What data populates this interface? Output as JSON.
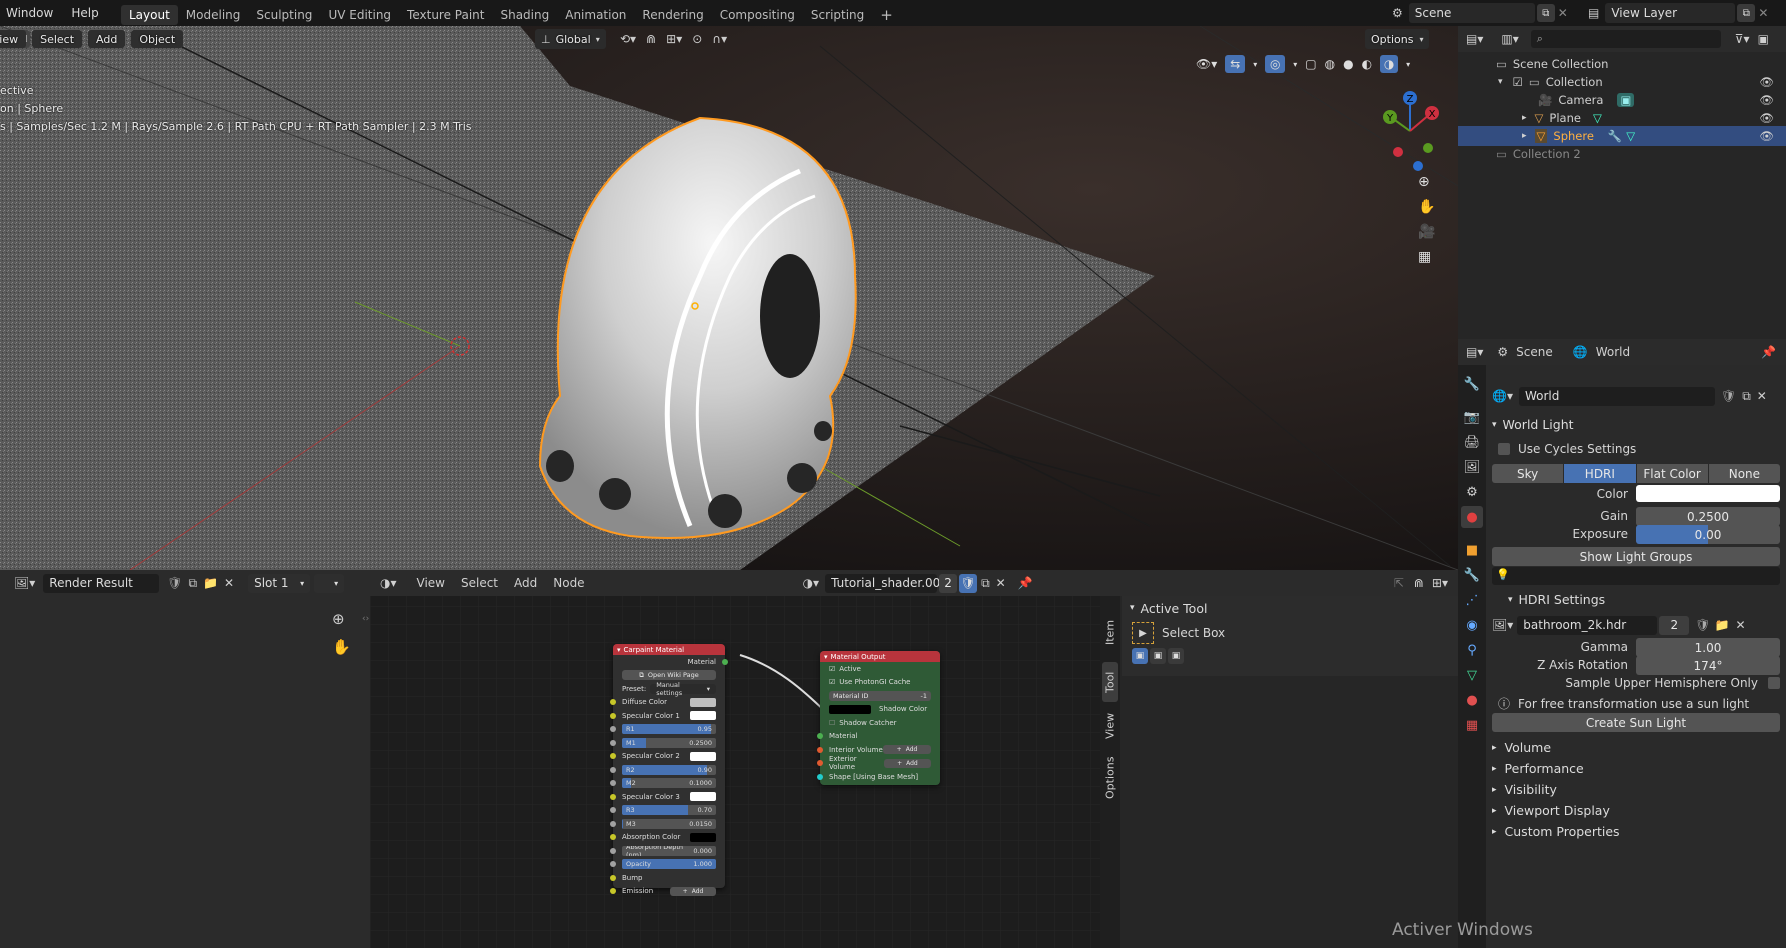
{
  "topbar": {
    "menus": [
      "View",
      "Select",
      "Add",
      "Object"
    ],
    "app_menus": [
      "Window",
      "Help"
    ],
    "workspaces": [
      "Layout",
      "Modeling",
      "Sculpting",
      "UV Editing",
      "Texture Paint",
      "Shading",
      "Animation",
      "Rendering",
      "Compositing",
      "Scripting"
    ],
    "active_workspace": "Layout",
    "add_tab": "+",
    "scene": "Scene",
    "view_layer": "View Layer"
  },
  "viewport": {
    "menus": [
      "View",
      "Select",
      "Add",
      "Object"
    ],
    "orientation": "Global",
    "options": "Options",
    "overlay_line1": "ective",
    "overlay_line2": "on | Sphere",
    "overlay_line3": "s | Samples/Sec 1.2 M | Rays/Sample 2.6 | RT Path CPU + RT Path Sampler | 2.3 M Tris",
    "gizmo": {
      "x": "X",
      "y": "Y",
      "z": "Z"
    }
  },
  "outliner": {
    "root": "Scene Collection",
    "items": [
      {
        "label": "Collection"
      },
      {
        "label": "Camera"
      },
      {
        "label": "Plane"
      },
      {
        "label": "Sphere"
      },
      {
        "label": "Collection 2"
      }
    ]
  },
  "properties": {
    "breadcrumb_scene": "Scene",
    "breadcrumb_world": "World",
    "world_name": "World",
    "world_light_panel": "World Light",
    "use_cycles": "Use Cycles Settings",
    "light_modes": [
      "Sky",
      "HDRI",
      "Flat Color",
      "None"
    ],
    "active_mode": "HDRI",
    "color_label": "Color",
    "gain_label": "Gain",
    "gain_value": "0.2500",
    "exposure_label": "Exposure",
    "exposure_value": "0.00",
    "show_light_groups": "Show Light Groups",
    "hdri_panel": "HDRI Settings",
    "hdri_file": "bathroom_2k.hdr",
    "hdri_users": "2",
    "gamma_label": "Gamma",
    "gamma_value": "1.00",
    "zrot_label": "Z Axis Rotation",
    "zrot_value": "174°",
    "sample_upper": "Sample Upper Hemisphere Only",
    "info_text": "For free transformation use a sun light",
    "create_sun": "Create Sun Light",
    "collapsed_panels": [
      "Volume",
      "Performance",
      "Visibility",
      "Viewport Display",
      "Custom Properties"
    ]
  },
  "image_editor": {
    "image_name": "Render Result",
    "slot": "Slot 1"
  },
  "node_editor": {
    "menus": [
      "View",
      "Select",
      "Add",
      "Node"
    ],
    "material": "Tutorial_shader.002",
    "users": "2",
    "sidebar_tabs": [
      "Item",
      "Tool",
      "View",
      "Options"
    ],
    "active_tool_panel": "Active Tool",
    "active_tool": "Select Box",
    "carpaint": {
      "title": "Carpaint Material",
      "output": "Material",
      "wiki_button": "Open Wiki Page",
      "preset_label": "Preset:",
      "preset_value": "Manual settings",
      "rows": [
        {
          "label": "Diffuse Color",
          "kind": "color",
          "color": "#bfbfbf"
        },
        {
          "label": "Specular Color 1",
          "kind": "color",
          "color": "#ffffff"
        },
        {
          "label": "R1",
          "kind": "bar",
          "value": "0.95",
          "fill": 0.95
        },
        {
          "label": "M1",
          "kind": "bar",
          "value": "0.2500",
          "fill": 0.25
        },
        {
          "label": "Specular Color 2",
          "kind": "color",
          "color": "#ffffff"
        },
        {
          "label": "R2",
          "kind": "bar",
          "value": "0.90",
          "fill": 0.9
        },
        {
          "label": "M2",
          "kind": "bar",
          "value": "0.1000",
          "fill": 0.1
        },
        {
          "label": "Specular Color 3",
          "kind": "color",
          "color": "#ffffff"
        },
        {
          "label": "R3",
          "kind": "bar",
          "value": "0.70",
          "fill": 0.7
        },
        {
          "label": "M3",
          "kind": "bar",
          "value": "0.0150",
          "fill": 0.015
        },
        {
          "label": "Absorption Color",
          "kind": "color",
          "color": "#000000"
        },
        {
          "label": "Absorption Depth (nm)",
          "kind": "bar",
          "value": "0.000",
          "fill": 0
        },
        {
          "label": "Opacity",
          "kind": "bar",
          "value": "1.000",
          "fill": 1
        },
        {
          "label": "Bump",
          "kind": "plain"
        },
        {
          "label": "Emission",
          "kind": "add",
          "button": "Add"
        }
      ]
    },
    "output_node": {
      "title": "Material Output",
      "active": "Active",
      "photongi": "Use PhotonGI Cache",
      "material_id_label": "Material ID",
      "material_id_value": "-1",
      "shadow_color": "Shadow Color",
      "shadow_catcher": "Shadow Catcher",
      "material": "Material",
      "interior": "Interior Volume",
      "exterior": "Exterior Volume",
      "add": "Add",
      "shape": "Shape [Using Base Mesh]"
    }
  },
  "watermark": "Activer Windows"
}
